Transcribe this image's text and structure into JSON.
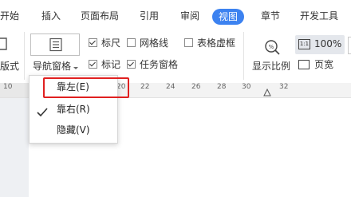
{
  "menubar": {
    "items": [
      "开始",
      "插入",
      "页面布局",
      "引用",
      "审阅",
      "视图",
      "章节",
      "开发工具"
    ],
    "active_index": 5
  },
  "ribbon": {
    "left_partial_label": "版式",
    "nav_pane_label": "导航窗格",
    "checkboxes": [
      {
        "label": "标尺",
        "checked": true
      },
      {
        "label": "网格线",
        "checked": false
      },
      {
        "label": "表格虚框",
        "checked": false
      },
      {
        "label": "标记",
        "checked": true
      },
      {
        "label": "任务窗格",
        "checked": true
      }
    ],
    "display_ratio_label": "显示比例",
    "zoom_label": "100%",
    "page_width_label": "页宽"
  },
  "ruler": {
    "ticks": [
      "10",
      "20",
      "22",
      "24",
      "26",
      "28",
      "30",
      "32"
    ]
  },
  "dropdown": {
    "items": [
      {
        "label": "靠左(E)",
        "checked": false,
        "highlighted": true
      },
      {
        "label": "靠右(R)",
        "checked": true,
        "highlighted": false
      },
      {
        "label": "隐藏(V)",
        "checked": false,
        "highlighted": false
      }
    ]
  },
  "colors": {
    "accent": "#3c82f0",
    "highlight_border": "#e02020"
  }
}
